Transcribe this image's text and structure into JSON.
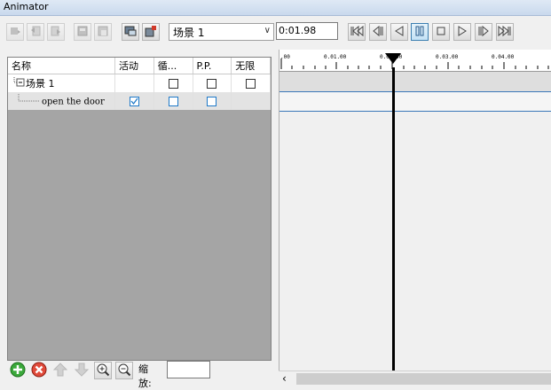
{
  "window": {
    "title": "Animator"
  },
  "toolbar": {
    "scene_value": "场景 1",
    "time_value": "0:01.98",
    "left_icons": [
      "add-keyframe-icon",
      "undo-icon",
      "redo-icon",
      "copy-icon",
      "paste-icon",
      "monitor-icon",
      "save-icon"
    ],
    "playback_icons": [
      "go-to-start-icon",
      "step-back-icon",
      "play-reverse-icon",
      "pause-icon",
      "stop-icon",
      "play-icon",
      "step-forward-icon",
      "go-to-end-icon"
    ]
  },
  "tree": {
    "columns": [
      "名称",
      "活动",
      "循...",
      "P.P.",
      "无限"
    ],
    "rows": [
      {
        "name": "场景 1",
        "active": false,
        "loop": false,
        "pp": false,
        "infinite": false
      },
      {
        "name": "open the door",
        "active": true,
        "loop": false,
        "pp": false
      }
    ]
  },
  "timeline": {
    "ticks": [
      ".00",
      "0.01.00",
      "0.02.00",
      "0.03.00",
      "0.04.00"
    ],
    "playhead_time": "0:01.98"
  },
  "bottom": {
    "zoom_label": "缩放:",
    "zoom_value": "",
    "icons": [
      "add-icon",
      "remove-icon",
      "move-up-icon",
      "move-down-icon",
      "zoom-in-icon",
      "zoom-out-icon"
    ]
  },
  "colors": {
    "accent": "#1e79c8",
    "track_line": "#3b78b8",
    "panel_gray": "#a5a5a5"
  }
}
